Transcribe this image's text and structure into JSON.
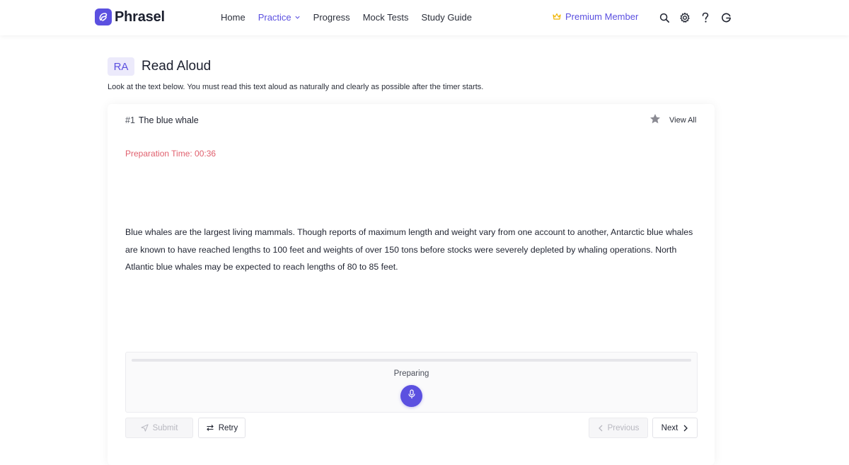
{
  "app": {
    "name": "Phrasel"
  },
  "nav": {
    "links": [
      {
        "label": "Home"
      },
      {
        "label": "Practice"
      },
      {
        "label": "Progress"
      },
      {
        "label": "Mock Tests"
      },
      {
        "label": "Study Guide"
      }
    ],
    "premium_label": "Premium Member",
    "icons": [
      "search-icon",
      "gear-icon",
      "help-icon",
      "account-icon"
    ]
  },
  "task": {
    "badge": "RA",
    "title": "Read Aloud",
    "instructions": "Look at the text below. You must read this text aloud as naturally and clearly as possible after the timer starts."
  },
  "question": {
    "number": "#1",
    "title": "The blue whale",
    "view_all_label": "View All",
    "prep_time_label": "Preparation Time: 00:36",
    "passage": "Blue whales are the largest living mammals. Though reports of maximum length and weight vary from one account to another, Antarctic blue whales are known to have reached lengths to 100 feet and weights of over 150 tons before stocks were severely depleted by whaling operations. North Atlantic blue whales may be expected to reach lengths of 80 to 85 feet."
  },
  "recorder": {
    "status": "Preparing",
    "progress": 0
  },
  "actions": {
    "submit_label": "Submit",
    "retry_label": "Retry",
    "previous_label": "Previous",
    "next_label": "Next"
  },
  "colors": {
    "accent": "#5b50e0",
    "prep_time": "#e0606e",
    "crown": "#f0b400"
  }
}
